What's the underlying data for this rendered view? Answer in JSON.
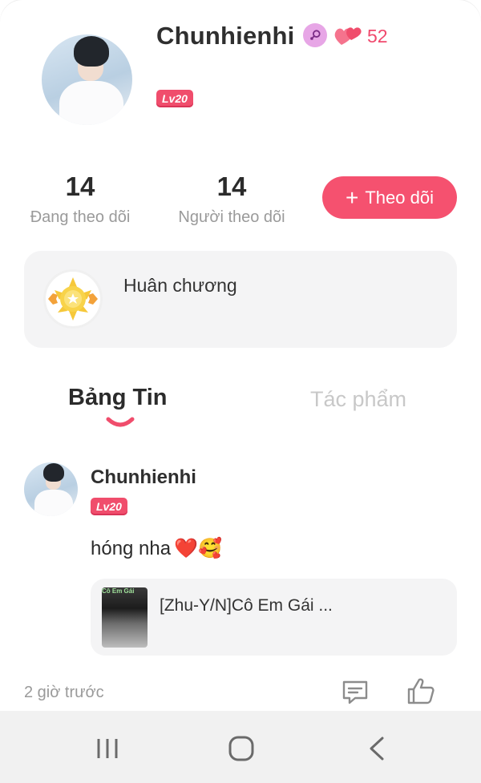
{
  "profile": {
    "username": "Chunhienhi",
    "likes_count": "52",
    "level": "Lv20"
  },
  "stats": {
    "following_count": "14",
    "following_label": "Đang theo dõi",
    "followers_count": "14",
    "followers_label": "Người theo dõi"
  },
  "follow_button": {
    "plus": "+",
    "label": "Theo dõi"
  },
  "medal": {
    "label": "Huân chương"
  },
  "tabs": [
    {
      "label": "Bảng Tin",
      "active": true
    },
    {
      "label": "Tác phẩm",
      "active": false
    }
  ],
  "post": {
    "author": "Chunhienhi",
    "level": "Lv20",
    "text": "hóng nha",
    "emojis": "❤️🥰",
    "song_title": "[Zhu-Y/N]Cô Em Gái ...",
    "song_thumb_tag": "Cô Em Gái",
    "time": "2 giờ trước"
  },
  "colors": {
    "accent": "#f5516f",
    "badge": "#f04d6c",
    "card_bg": "#f4f4f5",
    "muted_text": "#9a9a9a"
  },
  "icons": {
    "gender": "female-icon",
    "likes": "hearts-icon",
    "medal": "sun-medal-icon",
    "comment": "comment-icon",
    "like": "thumbs-up-icon",
    "nav": [
      "recent-apps-icon",
      "home-icon",
      "back-icon"
    ]
  }
}
